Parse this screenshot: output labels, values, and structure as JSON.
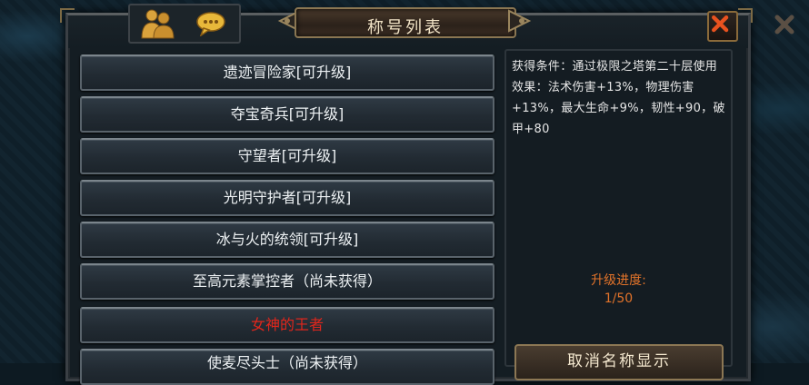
{
  "window": {
    "title": "称号列表"
  },
  "titles": [
    {
      "label": "遗迹冒险家[可升级]",
      "color": "#eef2f4"
    },
    {
      "label": "夺宝奇兵[可升级]",
      "color": "#eef2f4"
    },
    {
      "label": "守望者[可升级]",
      "color": "#eef2f4"
    },
    {
      "label": "光明守护者[可升级]",
      "color": "#eef2f4"
    },
    {
      "label": "冰与火的统领[可升级]",
      "color": "#eef2f4"
    },
    {
      "label": "至高元素掌控者（尚未获得）",
      "color": "#eef2f4"
    },
    {
      "label": "女神的王者",
      "color": "#e0261c"
    },
    {
      "label": "使麦尽头士（尚未获得）",
      "color": "#eef2f4"
    }
  ],
  "detail": {
    "description": "获得条件：通过极限之塔第二十层使用效果：法术伤害+13%，物理伤害+13%，最大生命+9%，韧性+90，破甲+80",
    "progress_label": "升级进度:",
    "progress_value": "1/50",
    "cancel_button": "取消名称显示"
  },
  "icons": {
    "people": "people-icon",
    "chat": "chat-bubble-icon",
    "close": "close-icon"
  },
  "colors": {
    "accent_gold": "#8a7652",
    "progress_orange": "#e2732a",
    "highlight_red": "#e0261c"
  }
}
